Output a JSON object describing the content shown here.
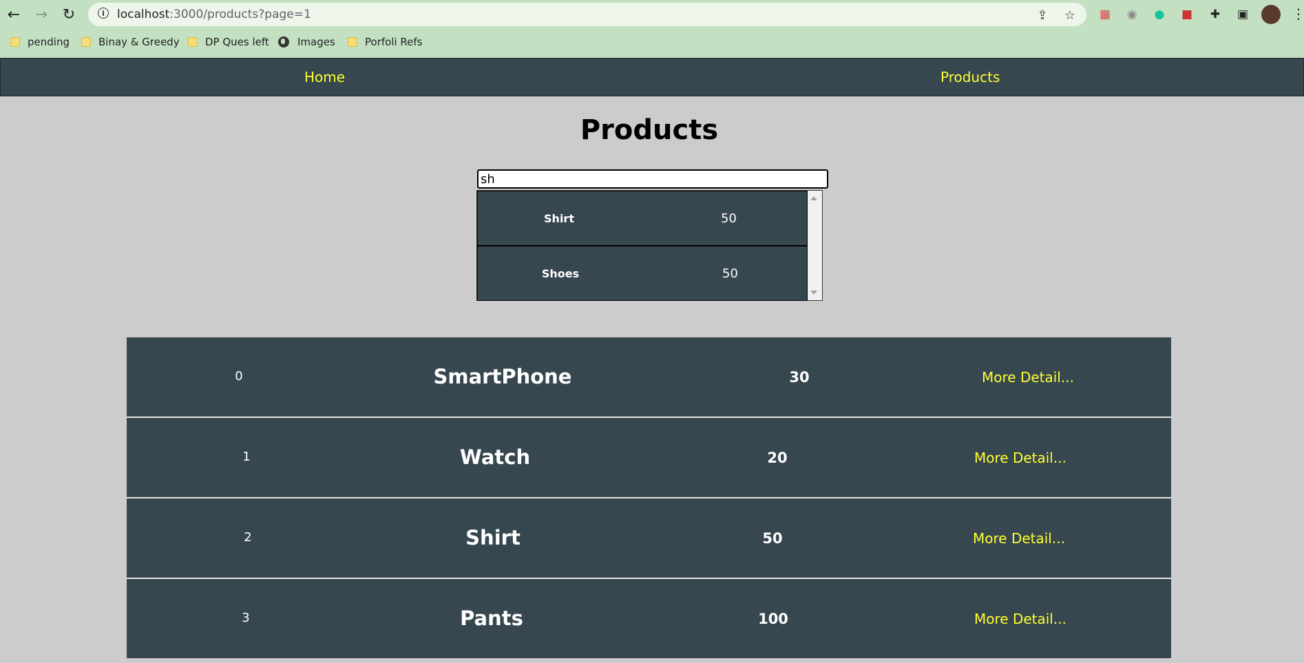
{
  "browser": {
    "url_host": "localhost",
    "url_rest": ":3000/products?page=1",
    "bookmarks": [
      {
        "label": "pending",
        "icon": "folder-icon"
      },
      {
        "label": "Binay & Greedy",
        "icon": "folder-icon"
      },
      {
        "label": "DP Ques left",
        "icon": "folder-icon"
      },
      {
        "label": "Images",
        "icon": "globe-icon"
      },
      {
        "label": "Porfoli Refs",
        "icon": "folder-icon"
      }
    ]
  },
  "nav": {
    "home": "Home",
    "products": "Products"
  },
  "page": {
    "title": "Products"
  },
  "search": {
    "value": "sh"
  },
  "suggestions": [
    {
      "name": "Shirt",
      "price": "50"
    },
    {
      "name": "Shoes",
      "price": "50"
    }
  ],
  "products": [
    {
      "index": "0",
      "name": "SmartPhone",
      "price": "30",
      "link": "More Detail..."
    },
    {
      "index": "1",
      "name": "Watch",
      "price": "20",
      "link": "More Detail..."
    },
    {
      "index": "2",
      "name": "Shirt",
      "price": "50",
      "link": "More Detail..."
    },
    {
      "index": "3",
      "name": "Pants",
      "price": "100",
      "link": "More Detail..."
    }
  ],
  "colors": {
    "nav_bg": "#37474f",
    "accent": "#ffff33",
    "page_bg": "#cccccc",
    "chrome_bg": "#c4e0c2"
  }
}
